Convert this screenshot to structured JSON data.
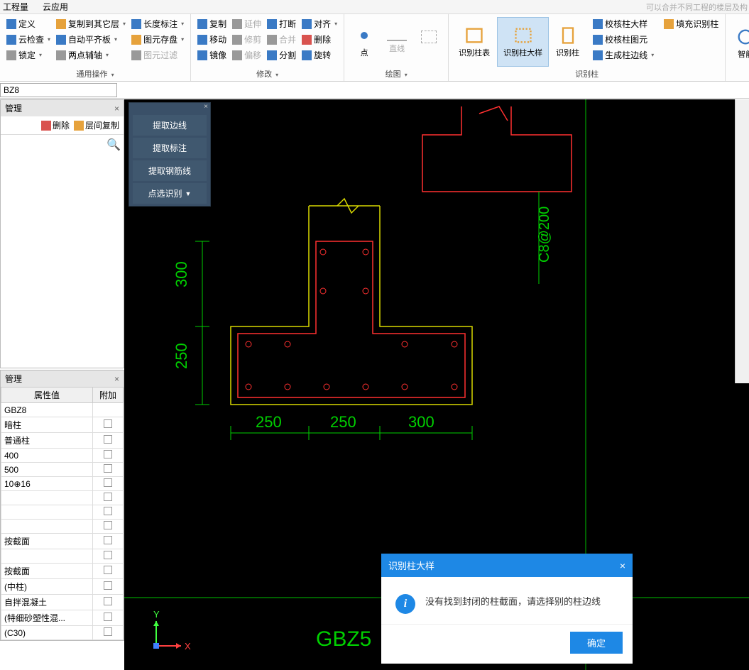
{
  "top_menu": {
    "items": [
      "工程量",
      "云应用"
    ]
  },
  "right_note": "可以合并不同工程的楼层及构",
  "ribbon": {
    "groups": [
      {
        "title": "通用操作",
        "cols": [
          [
            {
              "label": "定义",
              "icon": "i-blue"
            },
            {
              "label": "云检查",
              "icon": "i-blue",
              "dd": true
            },
            {
              "label": "锁定",
              "icon": "i-gray",
              "dd": true
            }
          ],
          [
            {
              "label": "复制到其它层",
              "icon": "i-orange",
              "dd": true
            },
            {
              "label": "自动平齐板",
              "icon": "i-blue",
              "dd": true
            },
            {
              "label": "两点辅轴",
              "icon": "i-gray",
              "dd": true
            }
          ],
          [
            {
              "label": "长度标注",
              "icon": "i-blue",
              "dd": true
            },
            {
              "label": "图元存盘",
              "icon": "i-orange",
              "dd": true
            },
            {
              "label": "图元过滤",
              "icon": "i-gray",
              "disabled": true
            }
          ]
        ]
      },
      {
        "title": "修改",
        "cols": [
          [
            {
              "label": "复制",
              "icon": "i-blue"
            },
            {
              "label": "移动",
              "icon": "i-blue"
            },
            {
              "label": "镜像",
              "icon": "i-blue"
            }
          ],
          [
            {
              "label": "延伸",
              "icon": "i-gray",
              "disabled": true
            },
            {
              "label": "修剪",
              "icon": "i-gray",
              "disabled": true
            },
            {
              "label": "偏移",
              "icon": "i-gray",
              "disabled": true
            }
          ],
          [
            {
              "label": "打断",
              "icon": "i-blue"
            },
            {
              "label": "合并",
              "icon": "i-gray",
              "disabled": true
            },
            {
              "label": "分割",
              "icon": "i-blue"
            }
          ],
          [
            {
              "label": "对齐",
              "icon": "i-blue",
              "dd": true
            },
            {
              "label": "删除",
              "icon": "i-red"
            },
            {
              "label": "旋转",
              "icon": "i-blue"
            }
          ]
        ]
      },
      {
        "title": "绘图",
        "big": [
          {
            "label": "点",
            "icon": "i-blue"
          },
          {
            "label": "直线",
            "icon": "i-gray",
            "disabled": true
          },
          {
            "label": "",
            "icon": "i-gray",
            "square": true,
            "disabled": true
          }
        ]
      },
      {
        "title": "识别柱",
        "big": [
          {
            "label": "识别柱表",
            "icon": "i-orange"
          },
          {
            "label": "识别柱大样",
            "icon": "i-orange",
            "active": true
          },
          {
            "label": "识别柱",
            "icon": "i-orange"
          }
        ],
        "side": [
          {
            "label": "校核柱大样",
            "icon": "i-blue"
          },
          {
            "label": "校核柱图元",
            "icon": "i-blue"
          },
          {
            "label": "生成柱边线",
            "icon": "i-blue",
            "dd": true
          }
        ],
        "side2": [
          {
            "label": "填充识别柱",
            "icon": "i-orange"
          }
        ]
      },
      {
        "title": "",
        "big": [
          {
            "label": "智能",
            "icon": "i-blue"
          }
        ]
      }
    ]
  },
  "combo_value": "BZ8",
  "panel1": {
    "title": "管理",
    "toolbar": [
      {
        "label": "删除",
        "icon": "i-red"
      },
      {
        "label": "层间复制",
        "icon": "i-orange"
      }
    ]
  },
  "panel2": {
    "title": "管理",
    "headers": [
      "属性值",
      "附加"
    ],
    "rows": [
      {
        "val": "GBZ8",
        "chk": false
      },
      {
        "val": "暗柱",
        "chk": true
      },
      {
        "val": "普通柱",
        "chk": true
      },
      {
        "val": "400",
        "chk": true
      },
      {
        "val": "500",
        "chk": true
      },
      {
        "val": "10⊕16",
        "chk": true
      },
      {
        "val": "",
        "chk": true
      },
      {
        "val": "",
        "chk": true
      },
      {
        "val": "",
        "chk": true
      },
      {
        "val": "按截面",
        "chk": true
      },
      {
        "val": "",
        "chk": true
      },
      {
        "val": "按截面",
        "chk": false
      },
      {
        "val": "(中柱)",
        "chk": true
      },
      {
        "val": "自拌混凝土",
        "chk": true
      },
      {
        "val": "(特细砂塑性混...",
        "chk": true
      },
      {
        "val": "(C30)",
        "chk": true
      }
    ]
  },
  "float_panel": {
    "buttons": [
      "提取边线",
      "提取标注",
      "提取钢筋线",
      "点选识别"
    ]
  },
  "cad": {
    "dims_v": [
      "300",
      "250"
    ],
    "dims_h": [
      "250",
      "250",
      "300"
    ],
    "annot_right": "C8@200",
    "label_bottom": "GBZ5",
    "axis": {
      "x": "X",
      "y": "Y"
    }
  },
  "dialog": {
    "title": "识别柱大样",
    "message": "没有找到封闭的柱截面，请选择别的柱边线",
    "ok": "确定"
  }
}
